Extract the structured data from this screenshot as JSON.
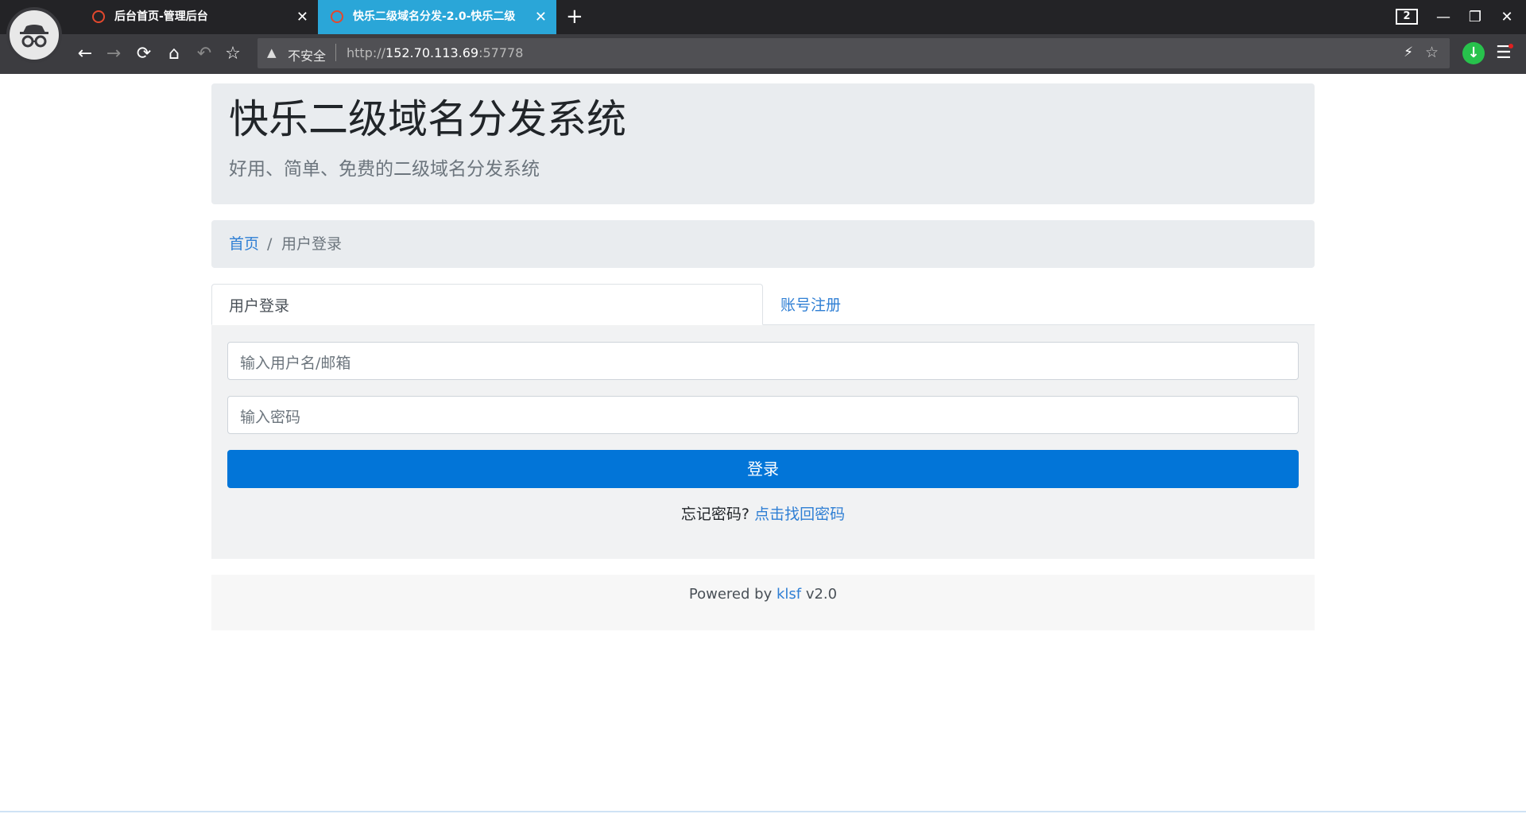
{
  "browser": {
    "tabs": [
      {
        "title": "后台首页-管理后台",
        "favicon": "dns-icon"
      },
      {
        "title": "快乐二级域名分发-2.0-快乐二级",
        "favicon": "globe-icon"
      }
    ],
    "new_tab_label": "+",
    "close_label": "✕",
    "tab_count": "2",
    "window": {
      "minimize": "—",
      "restore": "❐",
      "close": "✕"
    },
    "nav": {
      "back": "←",
      "forward": "→",
      "reload": "⟳",
      "home": "⌂",
      "undo": "↶",
      "bookmark": "☆"
    },
    "address": {
      "security_icon": "▲",
      "security_text": "不安全",
      "url_scheme": "http://",
      "url_host": "152.70.113.69",
      "url_port": ":57778"
    },
    "right_icons": {
      "bolt": "⚡",
      "star": "☆",
      "download": "↓",
      "menu": "☰"
    }
  },
  "header": {
    "title": "快乐二级域名分发系统",
    "subtitle": "好用、简单、免费的二级域名分发系统"
  },
  "breadcrumb": {
    "home": "首页",
    "separator": "/",
    "current": "用户登录"
  },
  "tabs": {
    "active": "用户登录",
    "other": "账号注册"
  },
  "form": {
    "username_placeholder": "输入用户名/邮箱",
    "password_placeholder": "输入密码",
    "submit_label": "登录",
    "forgot_text": "忘记密码?",
    "forgot_link": "点击找回密码"
  },
  "footer": {
    "powered_by": "Powered by",
    "brand": "klsf",
    "version": "v2.0"
  },
  "colors": {
    "accent": "#0275d8",
    "link": "#2f7fd4",
    "jumbotron": "#e9ecef",
    "active_tab_bg": "#2aa6d8"
  }
}
